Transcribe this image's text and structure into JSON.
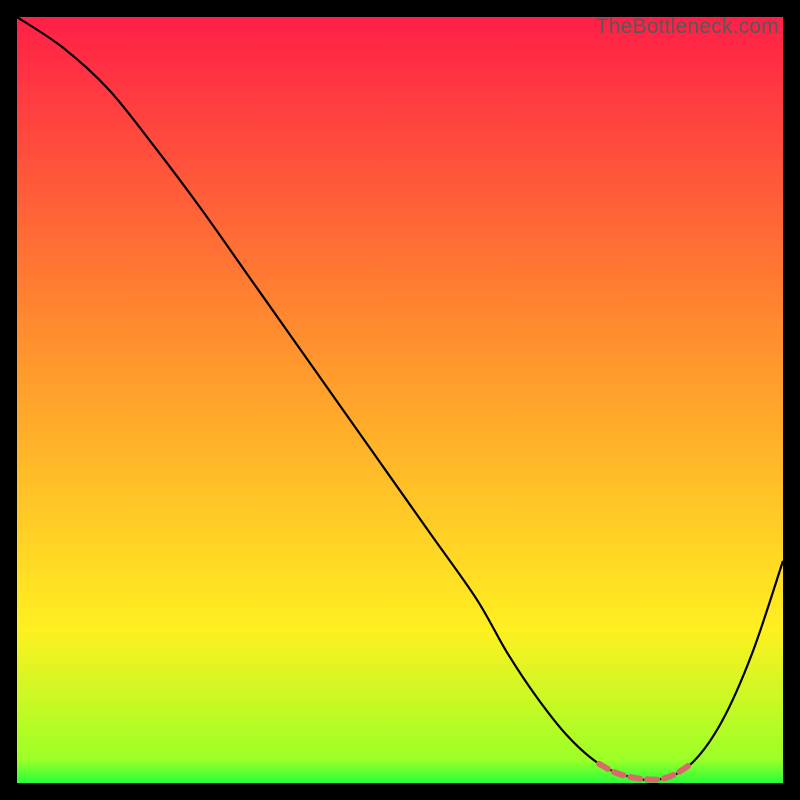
{
  "watermark": "TheBottleneck.com",
  "chart_data": {
    "type": "line",
    "title": "",
    "xlabel": "",
    "ylabel": "",
    "xlim": [
      0,
      100
    ],
    "ylim": [
      0,
      100
    ],
    "series": [
      {
        "name": "curve",
        "color": "#000000",
        "x": [
          0,
          6,
          12,
          18,
          24,
          30,
          36,
          42,
          48,
          54,
          60,
          64,
          68,
          72,
          76,
          80,
          84,
          88,
          92,
          96,
          100
        ],
        "y": [
          100,
          96,
          90.5,
          83,
          75,
          66.5,
          58,
          49.5,
          41,
          32.5,
          24,
          17,
          11,
          6,
          2.5,
          0.8,
          0.5,
          2.5,
          8,
          17,
          29
        ]
      },
      {
        "name": "highlight-band",
        "color": "#d96a6a",
        "width": 6,
        "x": [
          76,
          78,
          80,
          82,
          84,
          86,
          88
        ],
        "y": [
          2.5,
          1.4,
          0.8,
          0.5,
          0.5,
          1.2,
          2.5
        ]
      }
    ],
    "bands": [
      {
        "name": "green-band",
        "y0": 0.0,
        "y1": 3.0,
        "color0": "#27ff3a",
        "color1": "#9cff27"
      },
      {
        "name": "yellow-band",
        "y0": 3.0,
        "y1": 20.0,
        "color0": "#9cff27",
        "color1": "#fff021"
      },
      {
        "name": "mid-band",
        "y0": 20.0,
        "y1": 60.0,
        "color0": "#fff021",
        "color1": "#ff8a2f"
      },
      {
        "name": "red-band",
        "y0": 60.0,
        "y1": 100.0,
        "color0": "#ff8a2f",
        "color1": "#ff1f47"
      }
    ]
  }
}
